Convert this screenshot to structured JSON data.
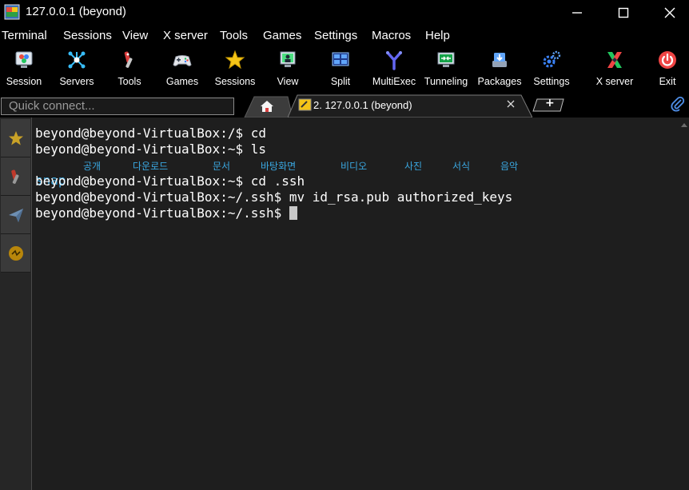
{
  "window": {
    "title": "127.0.0.1 (beyond)"
  },
  "menu": [
    "Terminal",
    "Sessions",
    "View",
    "X server",
    "Tools",
    "Games",
    "Settings",
    "Macros",
    "Help"
  ],
  "toolbar": [
    {
      "label": "Session",
      "icon": "session-icon"
    },
    {
      "label": "Servers",
      "icon": "servers-icon"
    },
    {
      "label": "Tools",
      "icon": "tools-icon"
    },
    {
      "label": "Games",
      "icon": "gamepad-icon"
    },
    {
      "label": "Sessions",
      "icon": "star-icon"
    },
    {
      "label": "View",
      "icon": "view-icon"
    },
    {
      "label": "Split",
      "icon": "split-icon"
    },
    {
      "label": "MultiExec",
      "icon": "multiexec-icon"
    },
    {
      "label": "Tunneling",
      "icon": "tunneling-icon"
    },
    {
      "label": "Packages",
      "icon": "packages-icon"
    },
    {
      "label": "Settings",
      "icon": "settings-icon"
    },
    {
      "label": "X server",
      "icon": "xserver-icon"
    },
    {
      "label": "Exit",
      "icon": "power-icon"
    }
  ],
  "quick_connect": {
    "placeholder": "Quick connect..."
  },
  "tabs": {
    "session_label": "2. 127.0.0.1 (beyond)",
    "new_tab_symbol": "+"
  },
  "sidebar": [
    "star-icon",
    "tools-icon",
    "send-icon",
    "macro-icon"
  ],
  "terminal": {
    "lines": [
      {
        "prompt": "beyond@beyond-VirtualBox:/$",
        "cmd": " cd"
      },
      {
        "prompt": "beyond@beyond-VirtualBox:~$",
        "cmd": " ls"
      },
      {
        "prompt": "beyond@beyond-VirtualBox:~$",
        "cmd": " cd .ssh"
      },
      {
        "prompt": "beyond@beyond-VirtualBox:~/.ssh$",
        "cmd": " mv id_rsa.pub authorized_keys"
      },
      {
        "prompt": "beyond@beyond-VirtualBox:~/.ssh$",
        "cmd": " "
      }
    ],
    "ls_output": [
      "snap",
      "공개",
      "다운로드",
      "문서",
      "바탕화면",
      "비디오",
      "사진",
      "서식",
      "음악"
    ]
  },
  "colors": {
    "background": "#1e1e1e",
    "directory": "#3aa7e0",
    "chrome": "#000000"
  }
}
